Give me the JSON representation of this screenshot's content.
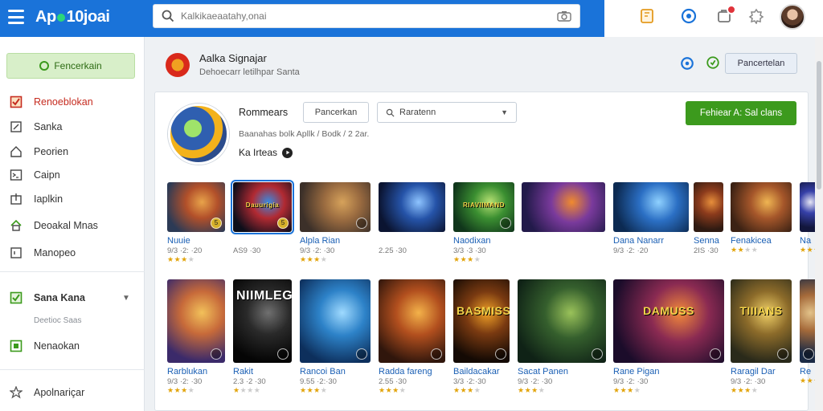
{
  "header": {
    "logo_a": "Ap",
    "logo_b": "10joai",
    "search_placeholder": "Kalkikaeaatahy,onai",
    "icons": [
      "hamburger-icon",
      "search-icon",
      "camera-icon",
      "bookmark-icon",
      "help-icon",
      "notification-icon",
      "settings-icon"
    ]
  },
  "sidebar": {
    "primary": "Fencerkain",
    "items": [
      {
        "label": "Renoeblokan",
        "icon": "checkbox-icon"
      },
      {
        "label": "Sanka",
        "icon": "edit-icon"
      },
      {
        "label": "Peorien",
        "icon": "home-icon"
      },
      {
        "label": "Caipn",
        "icon": "terminal-icon"
      },
      {
        "label": "Iaplkin",
        "icon": "export-icon"
      },
      {
        "label": "Deoakal Mnas",
        "icon": "house-icon"
      },
      {
        "label": "Manopeo",
        "icon": "copy-icon"
      }
    ],
    "group": {
      "label": "Sana Kana",
      "caption": "Deetioc Saas"
    },
    "extra": {
      "label": "Nenaokan"
    },
    "footer": {
      "label": "Apolnariçar"
    }
  },
  "main": {
    "brand_title": "Aalka Signajar",
    "brand_sub": "Dehoecarr letilhpar Santa",
    "head_button": "Pancertelan"
  },
  "app": {
    "name": "Rommears",
    "meta": "Baanahas bolk Apllk / Bodk / 2 2ar.",
    "link": "Ka Irteas",
    "filter_button": "Pancerkan",
    "sort_label": "Raratenn",
    "install_button": "Fehiear A: Sal clans"
  },
  "row1": [
    {
      "name": "Nuuie",
      "size": "9/3 ·2: ·20",
      "rating": 3,
      "badge": "5",
      "colors": [
        "#2c3a55",
        "#b2502a",
        "#e8a34a"
      ]
    },
    {
      "name": "",
      "size": "AS9 ·30",
      "rating": 0,
      "badge": "5",
      "colors": [
        "#0d0e1a",
        "#b12a32",
        "#3a8ae0"
      ],
      "title": "Dauurigia"
    },
    {
      "name": "Alpla Rian",
      "size": "",
      "rating": 3,
      "badge": "",
      "colors": [
        "#3c3029",
        "#9a6b40",
        "#d6a25b"
      ]
    },
    {
      "name": "",
      "size": "2.25 ·30",
      "rating": 0,
      "badge": "",
      "colors": [
        "#0b1431",
        "#2553a8",
        "#8ec4ff"
      ]
    },
    {
      "name": "Naodixan",
      "size": "",
      "rating": 3,
      "badge": "",
      "colors": [
        "#10361b",
        "#3b8f31",
        "#b8e274"
      ],
      "title": "RIAVIIMAND"
    },
    {
      "name": "",
      "size": "",
      "rating": 0,
      "badge": "",
      "colors": [
        "#221a4a",
        "#7a3a9c",
        "#f08a2e"
      ]
    },
    {
      "name": "Dana Nanarr",
      "size": "",
      "rating": 0,
      "badge": "",
      "colors": [
        "#0c2a52",
        "#2b6fc4",
        "#8fd1ff"
      ]
    },
    {
      "name": "Senna",
      "size": "2IS ·30",
      "rating": 0,
      "badge": "",
      "colors": [
        "#2e1a12",
        "#8c3b1c",
        "#e78f3b"
      ]
    },
    {
      "name": "Fenakicea",
      "size": "",
      "rating": 2,
      "badge": "",
      "colors": [
        "#3c2214",
        "#a5562a",
        "#efb552"
      ]
    },
    {
      "name": "Na",
      "size": "",
      "rating": 3,
      "badge": "",
      "colors": [
        "#12163c",
        "#3640a8",
        "#e6e6f5"
      ]
    }
  ],
  "row1_extra": {
    "alpla_size": "9/3 ·2: ·30",
    "naodixan_size": "3/3 ·3 ·30",
    "dana_size": "9/3 ·2: ·20"
  },
  "row2": [
    {
      "name": "Rarblukan",
      "size": "9/3 ·2: ·30",
      "rating": 3,
      "colors": [
        "#3b2a6a",
        "#c76a3a",
        "#f2c15a"
      ]
    },
    {
      "name": "Rakit",
      "size": "2.3 ·2 ·30",
      "rating": 1,
      "colors": [
        "#050505",
        "#2a2a2a",
        "#707070"
      ],
      "title": "NIIMLEG"
    },
    {
      "name": "Rancoi Ban",
      "size": "9.55 ·2:·30",
      "rating": 3,
      "colors": [
        "#0d2f5c",
        "#2d82c8",
        "#9fdaff"
      ]
    },
    {
      "name": "Radda fareng",
      "size": "2.55 ·30",
      "rating": 3,
      "colors": [
        "#30160c",
        "#b24f1e",
        "#f3b24a"
      ]
    },
    {
      "name": "Baildacakar",
      "size": "3/3 ·2:·30",
      "rating": 3,
      "colors": [
        "#140a04",
        "#7a3a11",
        "#f0a127"
      ],
      "title": "BASMISS"
    },
    {
      "name": "Sacat Panen",
      "size": "9/3 ·2: ·30",
      "rating": 3,
      "colors": [
        "#0f2216",
        "#355f2d",
        "#9ac25a"
      ]
    },
    {
      "name": "Rane Pigan",
      "size": "9/3 ·2: ·30",
      "rating": 3,
      "colors": [
        "#1b0c2a",
        "#8a2a52",
        "#f38a3a"
      ],
      "title": "DAMUSS"
    },
    {
      "name": "Raragil Dar",
      "size": "9/3 ·2: ·30",
      "rating": 3,
      "colors": [
        "#2a2a1a",
        "#8c6b2a",
        "#f0d067"
      ],
      "title": "TIIIANS"
    },
    {
      "name": "Re",
      "size": "",
      "rating": 3,
      "colors": [
        "#1a2a45",
        "#a56a3a",
        "#e3c38a"
      ]
    }
  ]
}
